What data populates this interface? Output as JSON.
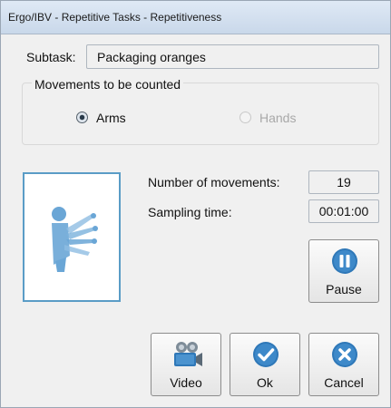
{
  "window": {
    "title": "Ergo/IBV - Repetitive Tasks - Repetitiveness"
  },
  "subtask": {
    "label": "Subtask:",
    "value": "Packaging oranges"
  },
  "movements_group": {
    "legend": "Movements to be counted",
    "options": [
      {
        "label": "Arms",
        "selected": true,
        "enabled": true
      },
      {
        "label": "Hands",
        "selected": false,
        "enabled": false
      }
    ]
  },
  "stats": {
    "num_movements_label": "Number of movements:",
    "num_movements_value": "19",
    "sampling_time_label": "Sampling time:",
    "sampling_time_value": "00:01:00"
  },
  "buttons": {
    "pause": "Pause",
    "video": "Video",
    "ok": "Ok",
    "cancel": "Cancel"
  },
  "colors": {
    "accent_blue": "#2f78b8",
    "figure_blue": "#6aa6d6"
  },
  "icons": {
    "figure": "worker-arms-motion-icon",
    "pause": "pause-icon",
    "video": "video-camera-icon",
    "ok": "checkmark-icon",
    "cancel": "close-icon"
  }
}
